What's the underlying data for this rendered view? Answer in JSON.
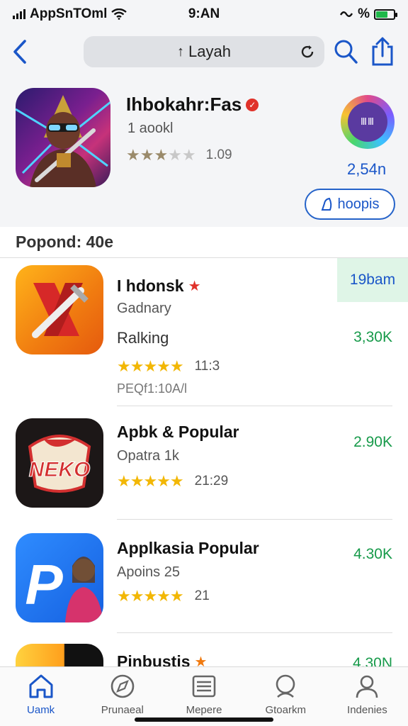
{
  "status_bar": {
    "carrier": "AppSnTOml",
    "time": "9:AN",
    "battery_text": "%"
  },
  "nav": {
    "search_text": "Layah",
    "accent": "#1a56c8"
  },
  "featured": {
    "title": "Ihbokahr:Fas",
    "subtitle": "1 aookl",
    "rating": "1.09",
    "badge_text": "ⅢⅢ",
    "count": "2,54n",
    "button_label": "hoopis"
  },
  "section": {
    "title": "Popond: 40e"
  },
  "apps": [
    {
      "title": "I hdonsk",
      "has_star": true,
      "line1": "Gadnary",
      "line2": "Ralking",
      "rating": "11:3",
      "line3": "PEQf1:10A/l",
      "value": "3,30K",
      "tag": "19bam",
      "stars": 5
    },
    {
      "title": "Apbk & Popular",
      "has_star": false,
      "line1": "Opatra 1k",
      "rating": "21:29",
      "value": "2.90K",
      "stars": 5,
      "icon_text": "NEKO"
    },
    {
      "title": "Applkasia Popular",
      "has_star": false,
      "line1": "Apoins 25",
      "rating": "21",
      "value": "4.30K",
      "stars": 5,
      "icon_text": "P"
    },
    {
      "title": "Pinbustis",
      "has_star": true,
      "value": "4,30N"
    }
  ],
  "tabs": [
    {
      "label": "Uamk",
      "icon": "home-icon",
      "active": true
    },
    {
      "label": "Prunaeal",
      "icon": "compass-icon",
      "active": false
    },
    {
      "label": "Mepere",
      "icon": "list-icon",
      "active": false
    },
    {
      "label": "Gtoarkm",
      "icon": "search-icon",
      "active": false
    },
    {
      "label": "Indenies",
      "icon": "person-icon",
      "active": false
    }
  ]
}
